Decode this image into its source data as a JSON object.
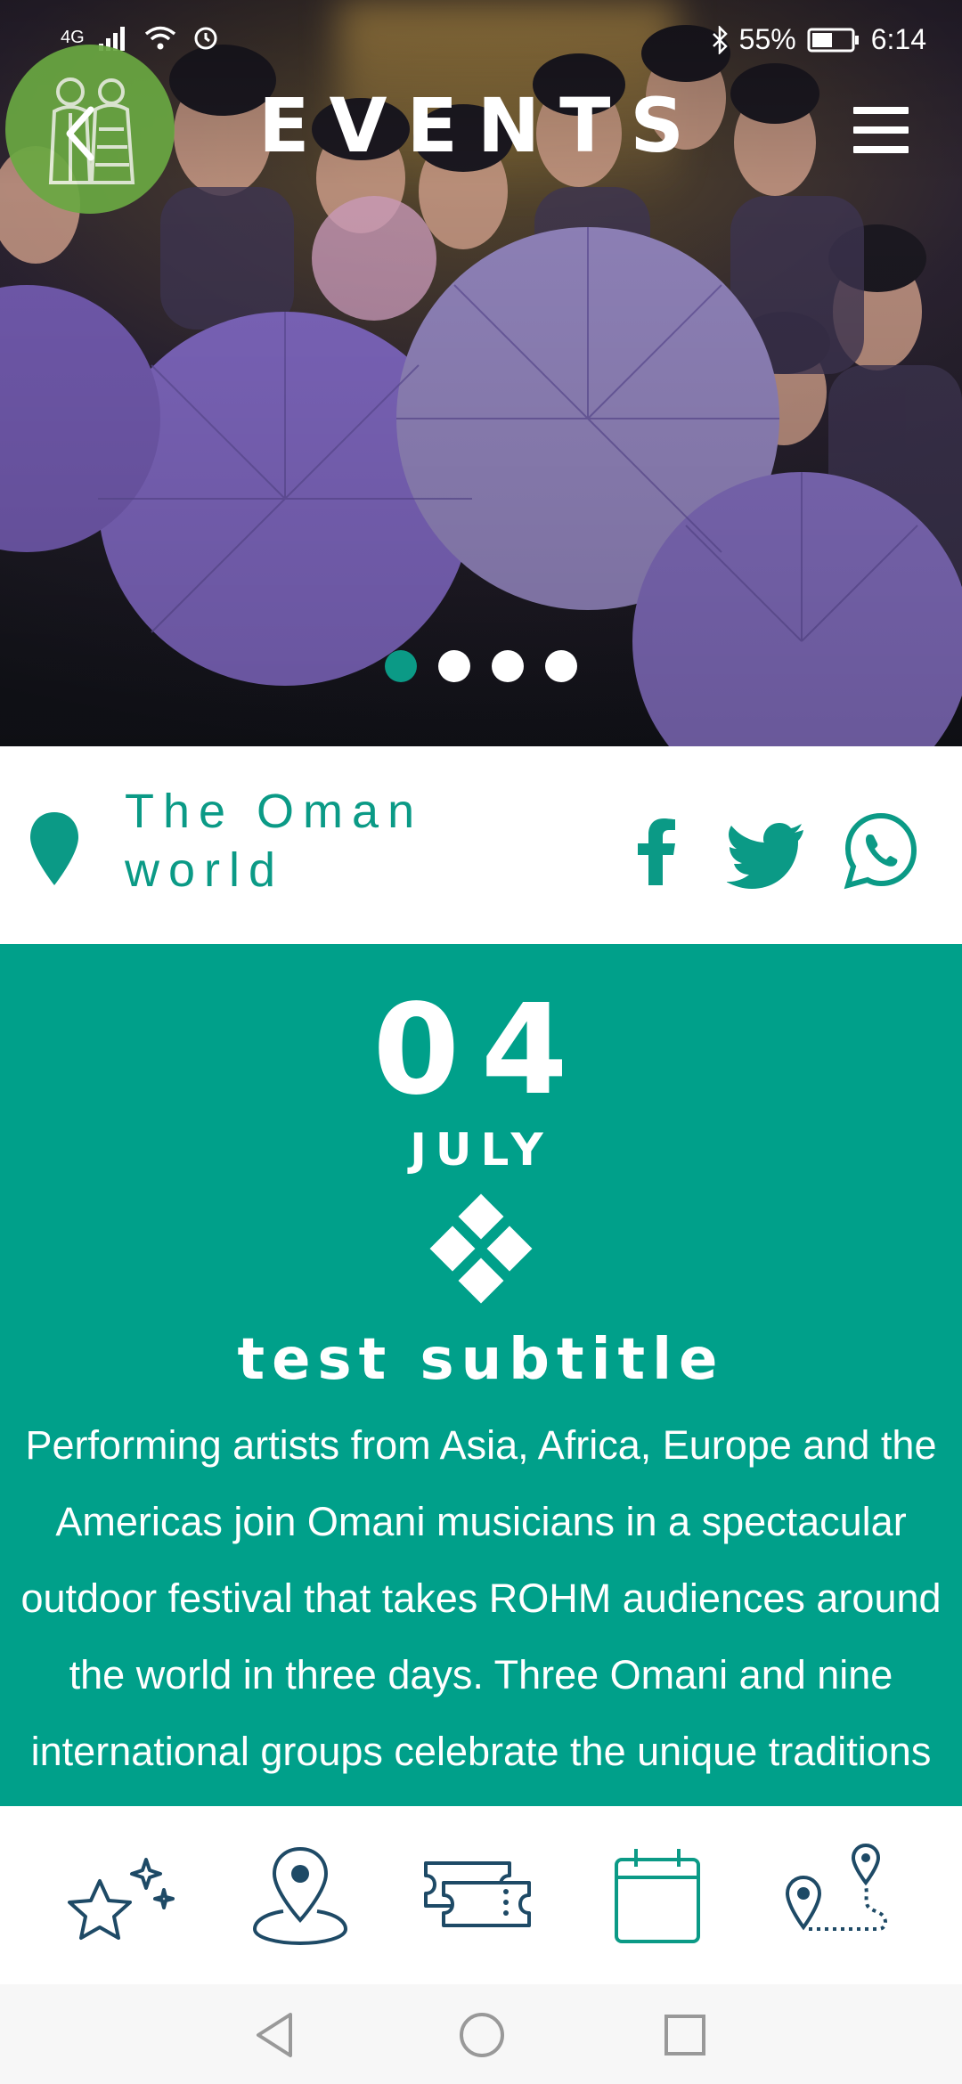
{
  "status_bar": {
    "network": "4G",
    "battery": "55%",
    "time": "6:14"
  },
  "header": {
    "title": "EVENTS"
  },
  "carousel": {
    "slide_count": 4,
    "active_index": 0
  },
  "event": {
    "location": "The Oman world",
    "location_line1": "The Oman",
    "location_line2": "world",
    "day": "04",
    "month": "JULY",
    "subtitle": "test subtitle",
    "description_lines": [
      "Performing artists from Asia, Africa, Europe and the",
      "Americas join Omani musicians in a spectacular",
      "outdoor festival that takes ROHM audiences around",
      "the world in three days. Three Omani and nine",
      "international groups celebrate the unique traditions"
    ]
  },
  "colors": {
    "teal": "#00a08a",
    "logo_green": "#6aa842",
    "nav_navy": "#1e4a66"
  },
  "icons": {
    "back": "chevron-left-icon",
    "menu": "hamburger-menu-icon",
    "location": "location-pin-icon",
    "facebook": "facebook-icon",
    "twitter": "twitter-icon",
    "whatsapp": "whatsapp-icon",
    "nav": [
      "sparkle-star-icon",
      "map-pin-icon",
      "tickets-icon",
      "calendar-icon",
      "route-icon"
    ]
  }
}
